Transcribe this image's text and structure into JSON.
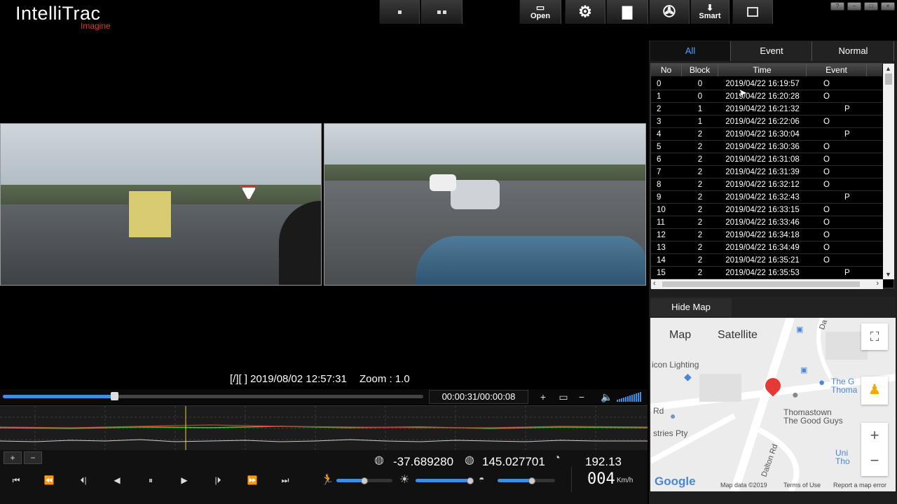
{
  "app": {
    "logo_title": "IntelliTrac",
    "logo_subtitle": "Imagine"
  },
  "toolbar": {
    "open_label": "Open",
    "smart_label": "Smart"
  },
  "video": {
    "osd_text": "[/][ ] 2019/08/02 12:57:31",
    "zoom_text": "Zoom : 1.0"
  },
  "playback": {
    "time_readout": "00:00:31/00:00:08",
    "progress": 0.27
  },
  "gps": {
    "latitude": "-37.689280",
    "longitude": "145.027701",
    "heading": "192.13",
    "speed": "004",
    "speed_unit": "Km/h"
  },
  "sliders": {
    "speed_level": 0.5,
    "brightness_level": 0.95,
    "contrast_level": 0.6
  },
  "filter_tabs": [
    "All",
    "Event",
    "Normal"
  ],
  "table": {
    "headers": [
      "No",
      "Block",
      "Time",
      "Event"
    ],
    "rows": [
      {
        "no": "0",
        "block": "0",
        "time": "2019/04/22 16:19:57",
        "e1": "O",
        "e2": ""
      },
      {
        "no": "1",
        "block": "0",
        "time": "2019/04/22 16:20:28",
        "e1": "O",
        "e2": ""
      },
      {
        "no": "2",
        "block": "1",
        "time": "2019/04/22 16:21:32",
        "e1": "",
        "e2": "P"
      },
      {
        "no": "3",
        "block": "1",
        "time": "2019/04/22 16:22:06",
        "e1": "O",
        "e2": ""
      },
      {
        "no": "4",
        "block": "2",
        "time": "2019/04/22 16:30:04",
        "e1": "",
        "e2": "P"
      },
      {
        "no": "5",
        "block": "2",
        "time": "2019/04/22 16:30:36",
        "e1": "O",
        "e2": ""
      },
      {
        "no": "6",
        "block": "2",
        "time": "2019/04/22 16:31:08",
        "e1": "O",
        "e2": ""
      },
      {
        "no": "7",
        "block": "2",
        "time": "2019/04/22 16:31:39",
        "e1": "O",
        "e2": ""
      },
      {
        "no": "8",
        "block": "2",
        "time": "2019/04/22 16:32:12",
        "e1": "O",
        "e2": ""
      },
      {
        "no": "9",
        "block": "2",
        "time": "2019/04/22 16:32:43",
        "e1": "",
        "e2": "P"
      },
      {
        "no": "10",
        "block": "2",
        "time": "2019/04/22 16:33:15",
        "e1": "O",
        "e2": ""
      },
      {
        "no": "11",
        "block": "2",
        "time": "2019/04/22 16:33:46",
        "e1": "O",
        "e2": ""
      },
      {
        "no": "12",
        "block": "2",
        "time": "2019/04/22 16:34:18",
        "e1": "O",
        "e2": ""
      },
      {
        "no": "13",
        "block": "2",
        "time": "2019/04/22 16:34:49",
        "e1": "O",
        "e2": ""
      },
      {
        "no": "14",
        "block": "2",
        "time": "2019/04/22 16:35:21",
        "e1": "O",
        "e2": ""
      },
      {
        "no": "15",
        "block": "2",
        "time": "2019/04/22 16:35:53",
        "e1": "",
        "e2": "P"
      }
    ]
  },
  "map": {
    "hide_map_label": "Hide Map",
    "type_map": "Map",
    "type_satellite": "Satellite",
    "labels": {
      "icon_lighting": "icon Lighting",
      "the_good_1": "The G",
      "the_good_2": "Thoma",
      "thomastown": "Thomastown",
      "good_guys": "The Good Guys",
      "rd": "Rd",
      "stries": "stries Pty",
      "dalton": "Dalton Rd",
      "da": "Da",
      "uni": "Uni",
      "tho": "Tho"
    },
    "google": "Google",
    "footer_data": "Map data ©2019",
    "footer_terms": "Terms of Use",
    "footer_report": "Report a map error"
  },
  "colors": {
    "accent": "#3d8fe0",
    "logo_red": "#e23b2c",
    "tab_active_text": "#4da3ff",
    "pin_red": "#e53935"
  }
}
